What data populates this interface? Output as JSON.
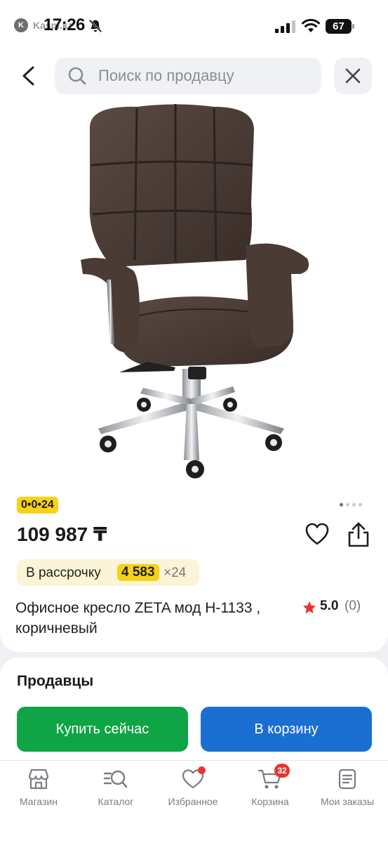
{
  "status_bar": {
    "app_icon_letter": "K",
    "app_name": "Kaspi.kz",
    "time": "17:26",
    "battery": "67"
  },
  "header": {
    "search_placeholder": "Поиск по продавцу"
  },
  "product": {
    "promo_badge": "0•0•24",
    "gallery_count": 4,
    "gallery_active_index": 0,
    "price": "109 987 ₸",
    "installment": {
      "label": "В рассрочку",
      "amount": "4 583",
      "term": "×24"
    },
    "title": "Офисное кресло ZETA мод Н-1133 , коричневый",
    "rating": {
      "value": "5.0",
      "count": "(0)"
    }
  },
  "sellers": {
    "heading": "Продавцы",
    "buy_now_label": "Купить сейчас",
    "add_to_cart_label": "В корзину"
  },
  "bottom_nav": {
    "items": [
      {
        "label": "Магазин",
        "icon": "store-icon"
      },
      {
        "label": "Каталог",
        "icon": "catalog-search-icon"
      },
      {
        "label": "Избранное",
        "icon": "heart-icon"
      },
      {
        "label": "Корзина",
        "icon": "cart-icon",
        "badge": "32"
      },
      {
        "label": "Мои заказы",
        "icon": "orders-icon"
      }
    ]
  },
  "colors": {
    "promo_yellow": "#f6d216",
    "buy_green": "#0fa546",
    "cart_blue": "#1b6fd0",
    "star_red": "#e8352e"
  }
}
